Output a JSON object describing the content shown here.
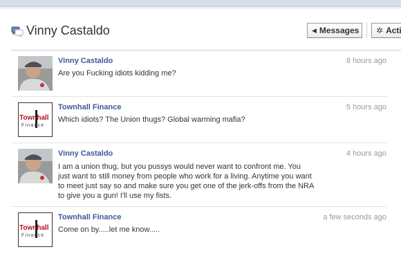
{
  "thread": {
    "title": "Vinny Castaldo",
    "icon": "chat-bubbles-icon",
    "buttons": {
      "messages_label": "Messages",
      "actions_label": "Actions"
    }
  },
  "messages": [
    {
      "author": "Vinny Castaldo",
      "time": "8 hours ago",
      "avatar": "vinny-photo",
      "body": "Are you Fucking idiots kidding me?"
    },
    {
      "author": "Townhall Finance",
      "time": "5 hours ago",
      "avatar": "townhall-logo",
      "body": "Which idiots? The Union thugs? Global warming mafia?"
    },
    {
      "author": "Vinny Castaldo",
      "time": "4 hours ago",
      "avatar": "vinny-photo",
      "body": "I am a union thug, but you pussys would never want to confront me. You just want to still money from people who work for a living. Anytime you want to meet just say so and make sure you get one of the jerk-offs from the NRA to give you a gun! I'll use my fists."
    },
    {
      "author": "Townhall Finance",
      "time": "a few seconds ago",
      "avatar": "townhall-logo",
      "body": "Come on by.....let me know....."
    }
  ],
  "logo_text": {
    "line1": "Townhall",
    "line2": "Finance"
  },
  "colors": {
    "link": "#3b5998",
    "timestamp": "#999999",
    "divider": "#e2e2e2"
  }
}
